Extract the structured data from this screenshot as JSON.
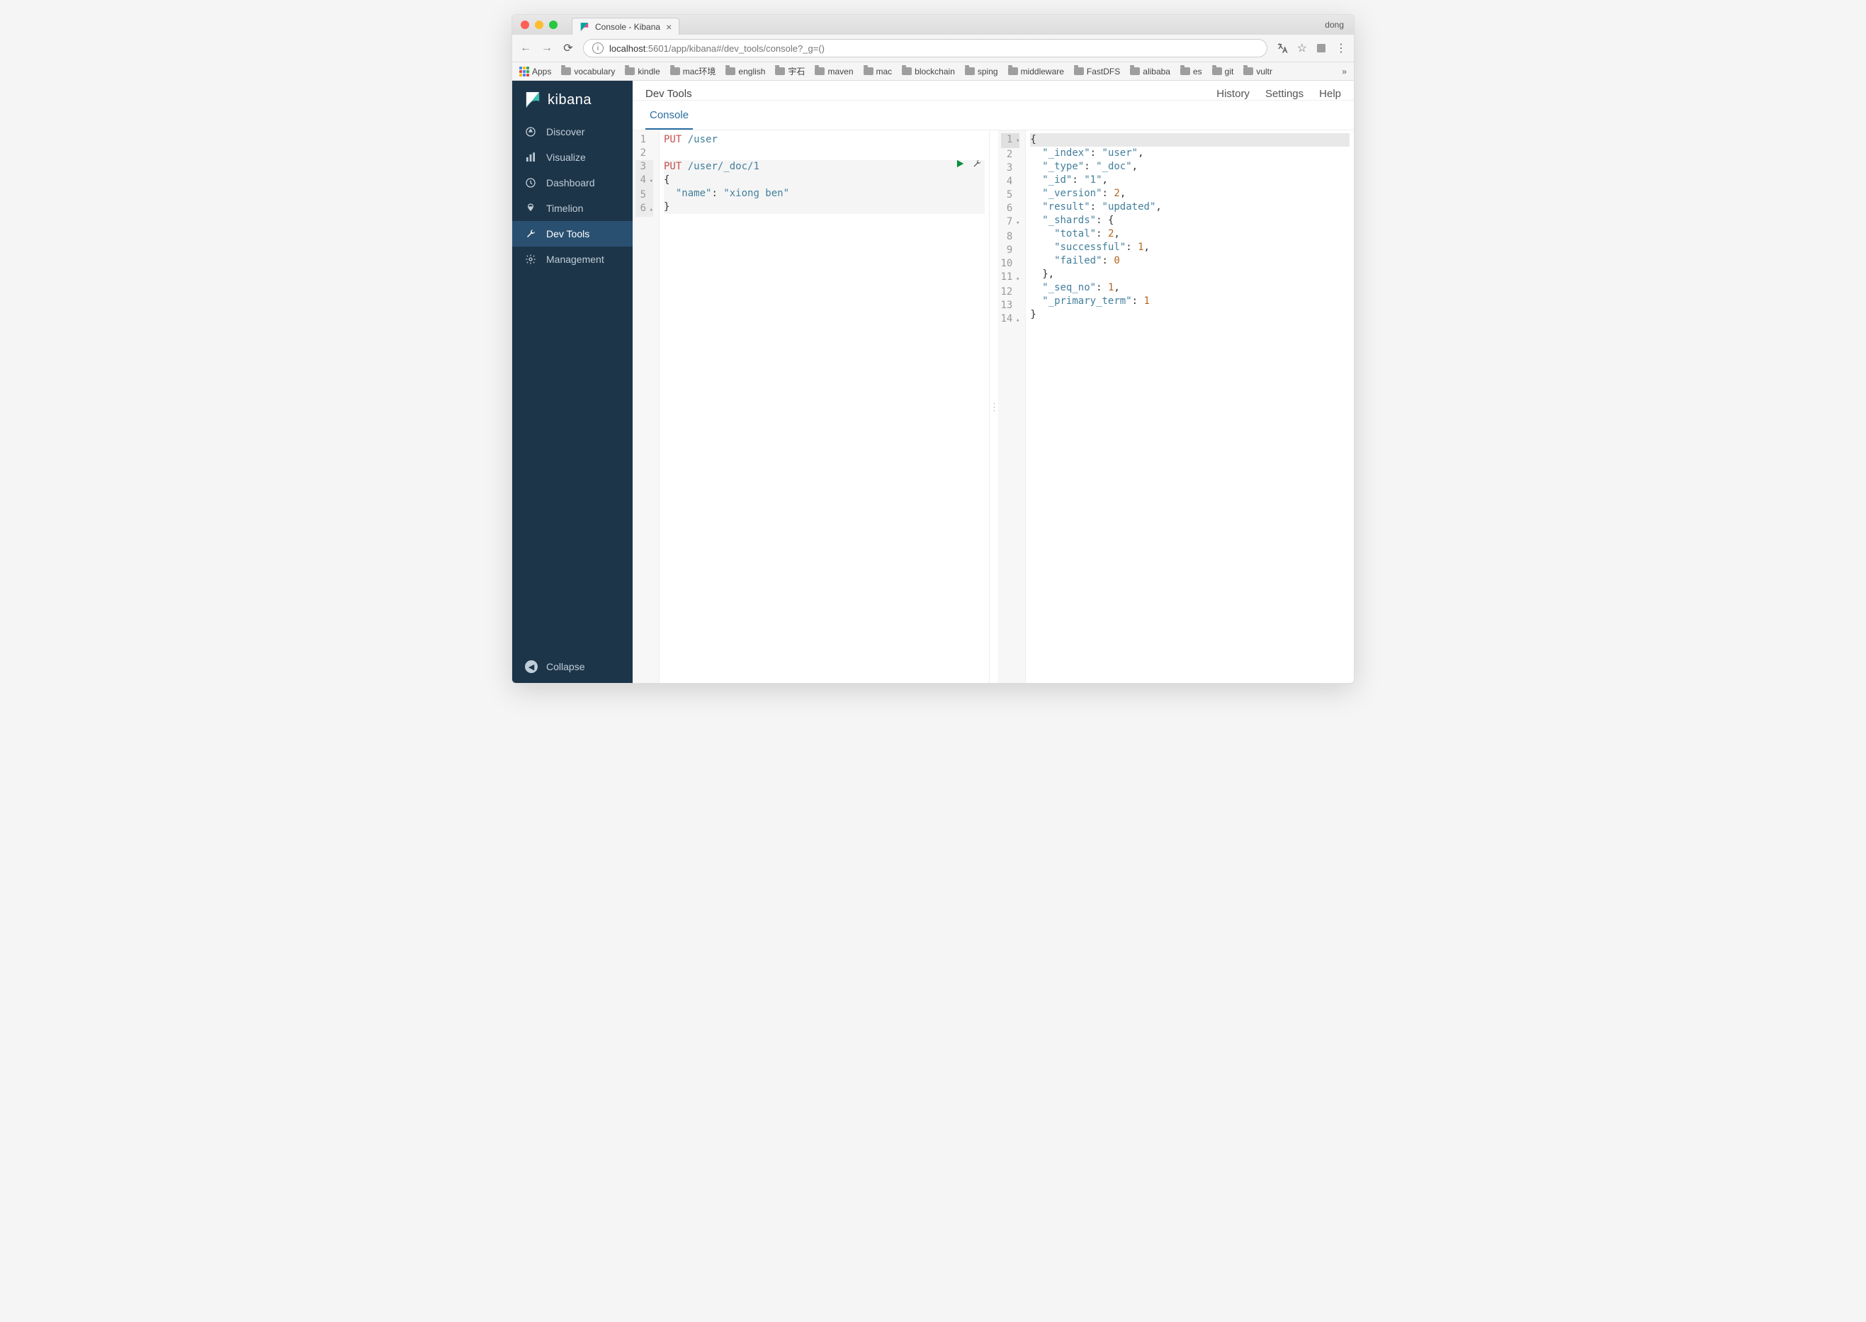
{
  "browser": {
    "profile": "dong",
    "tab_title": "Console - Kibana",
    "address": {
      "host": "localhost",
      "rest": ":5601/app/kibana#/dev_tools/console?_g=()"
    },
    "bookmarks": {
      "apps": "Apps",
      "items": [
        "vocabulary",
        "kindle",
        "mac环境",
        "english",
        "宇石",
        "maven",
        "mac",
        "blockchain",
        "sping",
        "middleware",
        "FastDFS",
        "alibaba",
        "es",
        "git",
        "vultr"
      ]
    }
  },
  "sidebar": {
    "brand": "kibana",
    "items": [
      {
        "label": "Discover"
      },
      {
        "label": "Visualize"
      },
      {
        "label": "Dashboard"
      },
      {
        "label": "Timelion"
      },
      {
        "label": "Dev Tools"
      },
      {
        "label": "Management"
      }
    ],
    "collapse": "Collapse"
  },
  "header": {
    "title": "Dev Tools",
    "links": {
      "history": "History",
      "settings": "Settings",
      "help": "Help"
    },
    "tab": "Console"
  },
  "editor": {
    "lines": [
      {
        "n": "1",
        "method": "PUT",
        "path": "/user"
      },
      {
        "n": "2",
        "raw": ""
      },
      {
        "n": "3",
        "method": "PUT",
        "path": "/user/_doc/1",
        "hl": true
      },
      {
        "n": "4",
        "raw": "{",
        "fold": "▾",
        "hl": true
      },
      {
        "n": "5",
        "indent": "  ",
        "key": "\"name\"",
        "val": "\"xiong ben\"",
        "hl": true
      },
      {
        "n": "6",
        "raw": "}",
        "fold": "▴",
        "hl": true
      }
    ]
  },
  "response": {
    "lines": [
      {
        "n": "1",
        "raw": "{",
        "fold": "▾",
        "hl": true
      },
      {
        "n": "2",
        "indent": "  ",
        "key": "\"_index\"",
        "val": "\"user\"",
        "comma": true
      },
      {
        "n": "3",
        "indent": "  ",
        "key": "\"_type\"",
        "val": "\"_doc\"",
        "comma": true
      },
      {
        "n": "4",
        "indent": "  ",
        "key": "\"_id\"",
        "val": "\"1\"",
        "comma": true
      },
      {
        "n": "5",
        "indent": "  ",
        "key": "\"_version\"",
        "num": "2",
        "comma": true
      },
      {
        "n": "6",
        "indent": "  ",
        "key": "\"result\"",
        "val": "\"updated\"",
        "comma": true
      },
      {
        "n": "7",
        "indent": "  ",
        "key": "\"_shards\"",
        "raw_after": "{",
        "fold": "▾",
        "comma": false
      },
      {
        "n": "8",
        "indent": "    ",
        "key": "\"total\"",
        "num": "2",
        "comma": true
      },
      {
        "n": "9",
        "indent": "    ",
        "key": "\"successful\"",
        "num": "1",
        "comma": true
      },
      {
        "n": "10",
        "indent": "    ",
        "key": "\"failed\"",
        "num": "0",
        "comma": false
      },
      {
        "n": "11",
        "indent": "  ",
        "raw": "},",
        "fold": "▴"
      },
      {
        "n": "12",
        "indent": "  ",
        "key": "\"_seq_no\"",
        "num": "1",
        "comma": true
      },
      {
        "n": "13",
        "indent": "  ",
        "key": "\"_primary_term\"",
        "num": "1",
        "comma": false
      },
      {
        "n": "14",
        "raw": "}",
        "fold": "▴"
      }
    ]
  }
}
